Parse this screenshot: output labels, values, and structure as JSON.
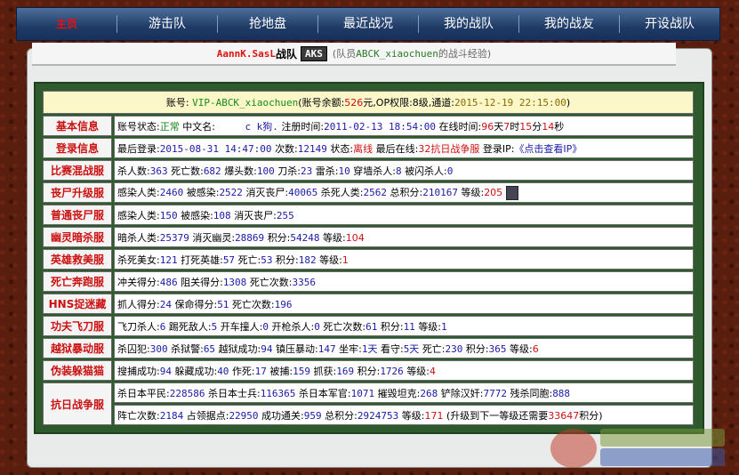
{
  "nav": {
    "items": [
      "主页",
      "游击队",
      "抢地盘",
      "最近战况",
      "我的战队",
      "我的战友",
      "开设战队"
    ]
  },
  "title": {
    "team_name": "AannK.SasL",
    "team_suffix": "战队",
    "logo": "AKS",
    "subtitle_prefix": "(队员",
    "member": "ABCK_xiaochuen",
    "subtitle_suffix": "的战斗经验)"
  },
  "account_header": {
    "label_account": "账号:",
    "account": "VIP-ABCK_xiaochuen",
    "balance_label": "(账号余额:",
    "balance": "526",
    "op_label": "元,OP权限:",
    "op": "8",
    "level_label": "级,通道:",
    "channel": "2015-12-19 22:15:00",
    "tail": ")"
  },
  "rows": [
    {
      "label": "基本信息"
    },
    {
      "label": "登录信息"
    },
    {
      "label": "比赛混战服"
    },
    {
      "label": "丧尸升级服"
    },
    {
      "label": "普通丧尸服"
    },
    {
      "label": "幽灵暗杀服"
    },
    {
      "label": "英雄救美服"
    },
    {
      "label": "死亡奔跑服"
    },
    {
      "label": "HNS捉迷藏"
    },
    {
      "label": "功夫飞刀服"
    },
    {
      "label": "越狱暴动服"
    },
    {
      "label": "伪装躲猫猫"
    },
    {
      "label": "抗日战争服"
    }
  ],
  "basic": {
    "status_label": "账号状态:",
    "status": "正常",
    "cn_label": "中文名:",
    "cn": "c k狗.",
    "reg_label": "注册时间:",
    "reg": "2011-02-13 18:54:00",
    "online_label": "在线时间:",
    "days": "96",
    "hours": "7",
    "mins": "15",
    "secs": "14",
    "u_day": "天",
    "u_hour": "时",
    "u_min": "分",
    "u_sec": "秒"
  },
  "login": {
    "last_label": "最后登录:",
    "last": "2015-08-31 14:47:00",
    "count_label": "次数:",
    "count": "12149",
    "state_label": "状态:",
    "state": "离线",
    "last_online_label": "最后在线:",
    "last_online": "32抗日战争服",
    "ip_label": "登录IP:",
    "ip_link": "《点击查看IP》"
  },
  "mixed": {
    "k1": "杀人数:",
    "v1": "363",
    "k2": "死亡数:",
    "v2": "682",
    "k3": "爆头数:",
    "v3": "100",
    "k4": "刀杀:",
    "v4": "23",
    "k5": "雷杀:",
    "v5": "10",
    "k6": "穿墙杀人:",
    "v6": "8",
    "k7": "被闪杀人:",
    "v7": "0"
  },
  "zombie_up": {
    "k1": "感染人类:",
    "v1": "2460",
    "k2": "被感染:",
    "v2": "2522",
    "k3": "消灭丧尸:",
    "v3": "40065",
    "k4": "杀死人类:",
    "v4": "2562",
    "k5": "总积分:",
    "v5": "210167",
    "k6": "等级:",
    "v6": "205"
  },
  "zombie_normal": {
    "k1": "感染人类:",
    "v1": "150",
    "k2": "被感染:",
    "v2": "108",
    "k3": "消灭丧尸:",
    "v3": "255"
  },
  "ghost": {
    "k1": "暗杀人类:",
    "v1": "25379",
    "k2": "消灭幽灵:",
    "v2": "28869",
    "k3": "积分:",
    "v3": "54248",
    "k4": "等级:",
    "v4": "104"
  },
  "hero": {
    "k1": "杀死美女:",
    "v1": "121",
    "k2": "打死英雄:",
    "v2": "57",
    "k3": "死亡:",
    "v3": "53",
    "k4": "积分:",
    "v4": "182",
    "k5": "等级:",
    "v5": "1"
  },
  "death_run": {
    "k1": "冲关得分:",
    "v1": "486",
    "k2": "阻关得分:",
    "v2": "1308",
    "k3": "死亡次数:",
    "v3": "3356"
  },
  "hns": {
    "k1": "抓人得分:",
    "v1": "24",
    "k2": "保命得分:",
    "v2": "51",
    "k3": "死亡次数:",
    "v3": "196"
  },
  "knife": {
    "k1": "飞刀杀人:",
    "v1": "6",
    "k2": "踢死敌人:",
    "v2": "5",
    "k3": "开车撞人:",
    "v3": "0",
    "k4": "开枪杀人:",
    "v4": "0",
    "k5": "死亡次数:",
    "v5": "61",
    "k6": "积分:",
    "v6": "11",
    "k7": "等级:",
    "v7": "1"
  },
  "jail": {
    "k1": "杀囚犯:",
    "v1": "300",
    "k2": "杀狱警:",
    "v2": "65",
    "k3": "越狱成功:",
    "v3": "94",
    "k4": "镇压暴动:",
    "v4": "147",
    "k5": "坐牢:",
    "v5": "1天",
    "k6": "看守:",
    "v6": "5天",
    "k7": "死亡:",
    "v7": "230",
    "k8": "积分:",
    "v8": "365",
    "k9": "等级:",
    "v9": "6"
  },
  "hide": {
    "k1": "搜捕成功:",
    "v1": "94",
    "k2": "躲藏成功:",
    "v2": "40",
    "k3": "作死:",
    "v3": "17",
    "k4": "被捕:",
    "v4": "159",
    "k5": "抓获:",
    "v5": "169",
    "k6": "积分:",
    "v6": "1726",
    "k7": "等级:",
    "v7": "4"
  },
  "war": {
    "k1": "杀日本平民:",
    "v1": "228586",
    "k2": "杀日本士兵:",
    "v2": "116365",
    "k3": "杀日本军官:",
    "v3": "1071",
    "k4": "摧毁坦克:",
    "v4": "268",
    "k5": "铲除汉奸:",
    "v5": "7772",
    "k6": "残杀同胞:",
    "v6": "888",
    "k7": "阵亡次数:",
    "v7": "2184",
    "k8": "占领据点:",
    "v8": "22950",
    "k9": "成功通关:",
    "v9": "959",
    "k10": "总积分:",
    "v10": "2924753",
    "k11": "等级:",
    "v11": "171",
    "up_prefix": "(升级到下一等级还需要",
    "up": "33647",
    "up_suffix": "积分)"
  },
  "colors": {
    "nav_bg": "#1f3b66",
    "label_red": "#cc1111",
    "table_border": "#2e5a2e",
    "value_blue": "#1a1aa8"
  }
}
